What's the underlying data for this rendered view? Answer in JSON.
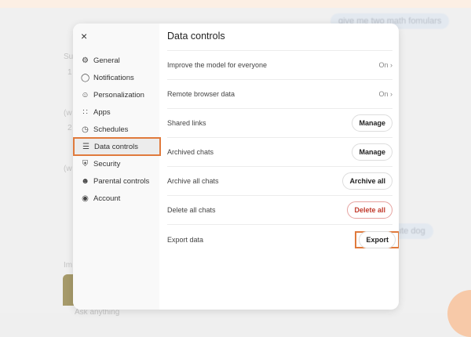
{
  "background": {
    "bubble_top": "give me two math fomulars",
    "bubble_mid": "ute dog",
    "ghost_texts": [
      "Su",
      "1",
      "(w",
      "2",
      "(w",
      "Im"
    ],
    "input_placeholder": "Ask anything"
  },
  "modal": {
    "close_label": "×",
    "nav": [
      {
        "label": "General",
        "icon": "gear-icon",
        "glyph": "⚙"
      },
      {
        "label": "Notifications",
        "icon": "bell-icon",
        "glyph": "◯"
      },
      {
        "label": "Personalization",
        "icon": "smile-icon",
        "glyph": "☺"
      },
      {
        "label": "Apps",
        "icon": "grid-icon",
        "glyph": "∷"
      },
      {
        "label": "Schedules",
        "icon": "clock-icon",
        "glyph": "◷"
      },
      {
        "label": "Data controls",
        "icon": "database-icon",
        "glyph": "☰"
      },
      {
        "label": "Security",
        "icon": "shield-icon",
        "glyph": "⛨"
      },
      {
        "label": "Parental controls",
        "icon": "people-icon",
        "glyph": "☻"
      },
      {
        "label": "Account",
        "icon": "user-circle-icon",
        "glyph": "◉"
      }
    ],
    "title": "Data controls",
    "rows": [
      {
        "label": "Improve the model for everyone",
        "value": "On",
        "chevron": "›"
      },
      {
        "label": "Remote browser data",
        "value": "On",
        "chevron": "›"
      },
      {
        "label": "Shared links",
        "button": "Manage"
      },
      {
        "label": "Archived chats",
        "button": "Manage"
      },
      {
        "label": "Archive all chats",
        "button": "Archive all"
      },
      {
        "label": "Delete all chats",
        "button": "Delete all"
      },
      {
        "label": "Export data",
        "button": "Export"
      }
    ],
    "accent": "#e07a3c",
    "danger": "#c0392b"
  }
}
